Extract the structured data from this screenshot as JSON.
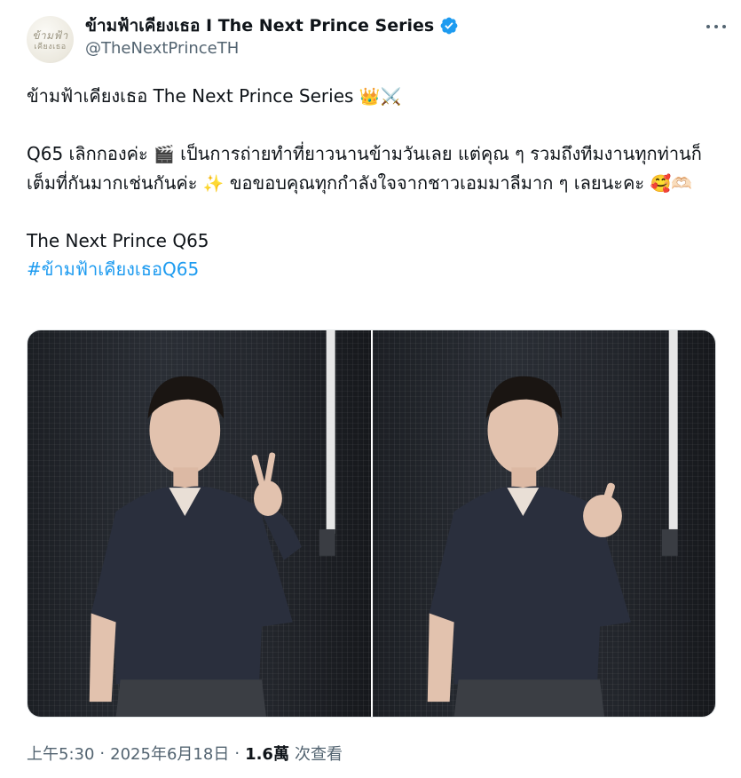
{
  "account": {
    "display_name": "ข้ามฟ้าเคียงเธอ I The Next Prince Series",
    "handle": "@TheNextPrinceTH",
    "avatar_text_line1": "ข้ามฟ้า",
    "avatar_text_line2": "เคียงเธอ",
    "verified_icon": "verified-badge-icon",
    "verified_color": "#1d9bf0"
  },
  "tweet": {
    "line1": "ข้ามฟ้าเคียงเธอ The Next Prince Series",
    "line1_emoji": "👑⚔️",
    "para2_part1": "Q65 เลิกกองค่ะ ",
    "para2_emoji1": "🎬",
    "para2_part2": " เป็นการถ่ายทำที่ยาวนานข้ามวันเลย แต่คุณ ๆ รวมถึงทีมงานทุกท่านก็เต็มที่กันมากเช่นกันค่ะ ",
    "para2_emoji2": "✨",
    "para2_part3": " ขอขอบคุณทุกกำลังใจจากชาวเอมมาลีมาก ๆ เลยนะคะ ",
    "para2_emoji3": "🥰🫶🏻",
    "line_title": "The Next Prince Q65",
    "hashtag": "#ข้ามฟ้าเคียงเธอQ65"
  },
  "media": {
    "photo_left_alt": "photo-peace-sign",
    "photo_right_alt": "photo-thumbs-up"
  },
  "meta": {
    "time": "上午5:30",
    "sep1": "·",
    "date": "2025年6月18日",
    "sep2": "·",
    "views_count": "1.6萬",
    "views_label": "次查看"
  },
  "colors": {
    "link": "#1d9bf0",
    "secondary_text": "#536471",
    "primary_text": "#0f1419"
  }
}
